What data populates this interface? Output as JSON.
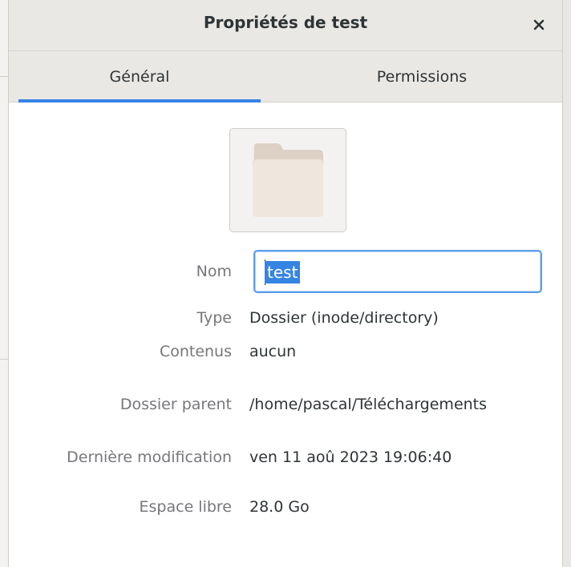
{
  "window": {
    "title": "Propriétés de test",
    "close_label": "×"
  },
  "tabs": [
    {
      "label": "Général",
      "active": true
    },
    {
      "label": "Permissions",
      "active": false
    }
  ],
  "folder_icon": "folder-icon",
  "fields": {
    "name": {
      "label": "Nom",
      "value": "test"
    },
    "type": {
      "label": "Type",
      "value": "Dossier (inode/directory)"
    },
    "contents": {
      "label": "Contenus",
      "value": "aucun"
    },
    "parent": {
      "label": "Dossier parent",
      "value": "/home/pascal/Téléchargements"
    },
    "modified": {
      "label": "Dernière modification",
      "value": "ven 11 aoû 2023 19:06:40"
    },
    "free_space": {
      "label": "Espace libre",
      "value": "28.0 Go"
    }
  },
  "colors": {
    "accent": "#3584e4",
    "label": "#77767b",
    "text": "#2e3436",
    "folder_back": "#ddd0c4",
    "folder_front": "#efe7de"
  }
}
